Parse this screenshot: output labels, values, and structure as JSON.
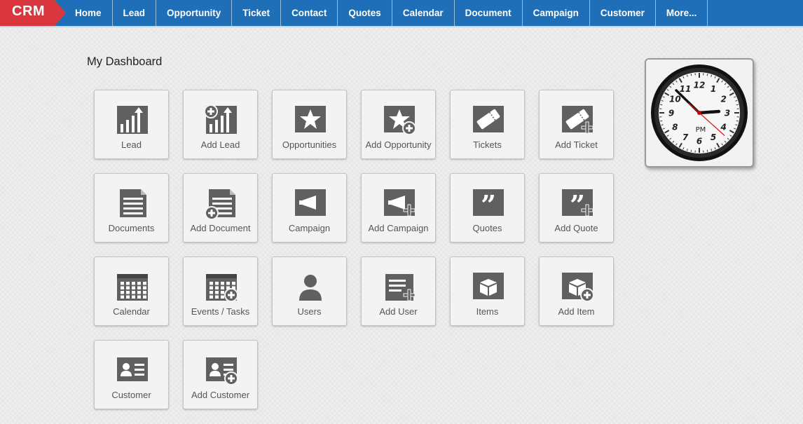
{
  "brand": {
    "name": "CRM",
    "color": "#d9363e"
  },
  "nav": {
    "items": [
      "Home",
      "Lead",
      "Opportunity",
      "Ticket",
      "Contact",
      "Quotes",
      "Calendar",
      "Document",
      "Campaign",
      "Customer",
      "More..."
    ],
    "color": "#1e6fb7"
  },
  "dashboard": {
    "title": "My Dashboard",
    "tiles": [
      {
        "label": "Lead",
        "icon": "bar-chart-icon"
      },
      {
        "label": "Add Lead",
        "icon": "bar-chart-add-icon"
      },
      {
        "label": "Opportunities",
        "icon": "star-icon"
      },
      {
        "label": "Add Opportunity",
        "icon": "star-add-icon"
      },
      {
        "label": "Tickets",
        "icon": "ticket-icon"
      },
      {
        "label": "Add Ticket",
        "icon": "ticket-add-icon"
      },
      {
        "label": "Documents",
        "icon": "document-icon"
      },
      {
        "label": "Add Document",
        "icon": "document-add-icon"
      },
      {
        "label": "Campaign",
        "icon": "megaphone-icon"
      },
      {
        "label": "Add Campaign",
        "icon": "megaphone-add-icon"
      },
      {
        "label": "Quotes",
        "icon": "quote-icon"
      },
      {
        "label": "Add Quote",
        "icon": "quote-add-icon"
      },
      {
        "label": "Calendar",
        "icon": "calendar-icon"
      },
      {
        "label": "Events / Tasks",
        "icon": "calendar-add-icon"
      },
      {
        "label": "Users",
        "icon": "user-icon"
      },
      {
        "label": "Add User",
        "icon": "user-add-icon"
      },
      {
        "label": "Items",
        "icon": "box-icon"
      },
      {
        "label": "Add Item",
        "icon": "box-add-icon"
      },
      {
        "label": "Customer",
        "icon": "contact-card-icon"
      },
      {
        "label": "Add Customer",
        "icon": "contact-card-add-icon"
      }
    ],
    "icon_color": "#606060"
  },
  "clock": {
    "numbers": [
      "12",
      "1",
      "2",
      "3",
      "4",
      "5",
      "6",
      "7",
      "8",
      "9",
      "10",
      "11"
    ],
    "period": "PM",
    "hour": 2,
    "minute": 52,
    "second": 22
  }
}
